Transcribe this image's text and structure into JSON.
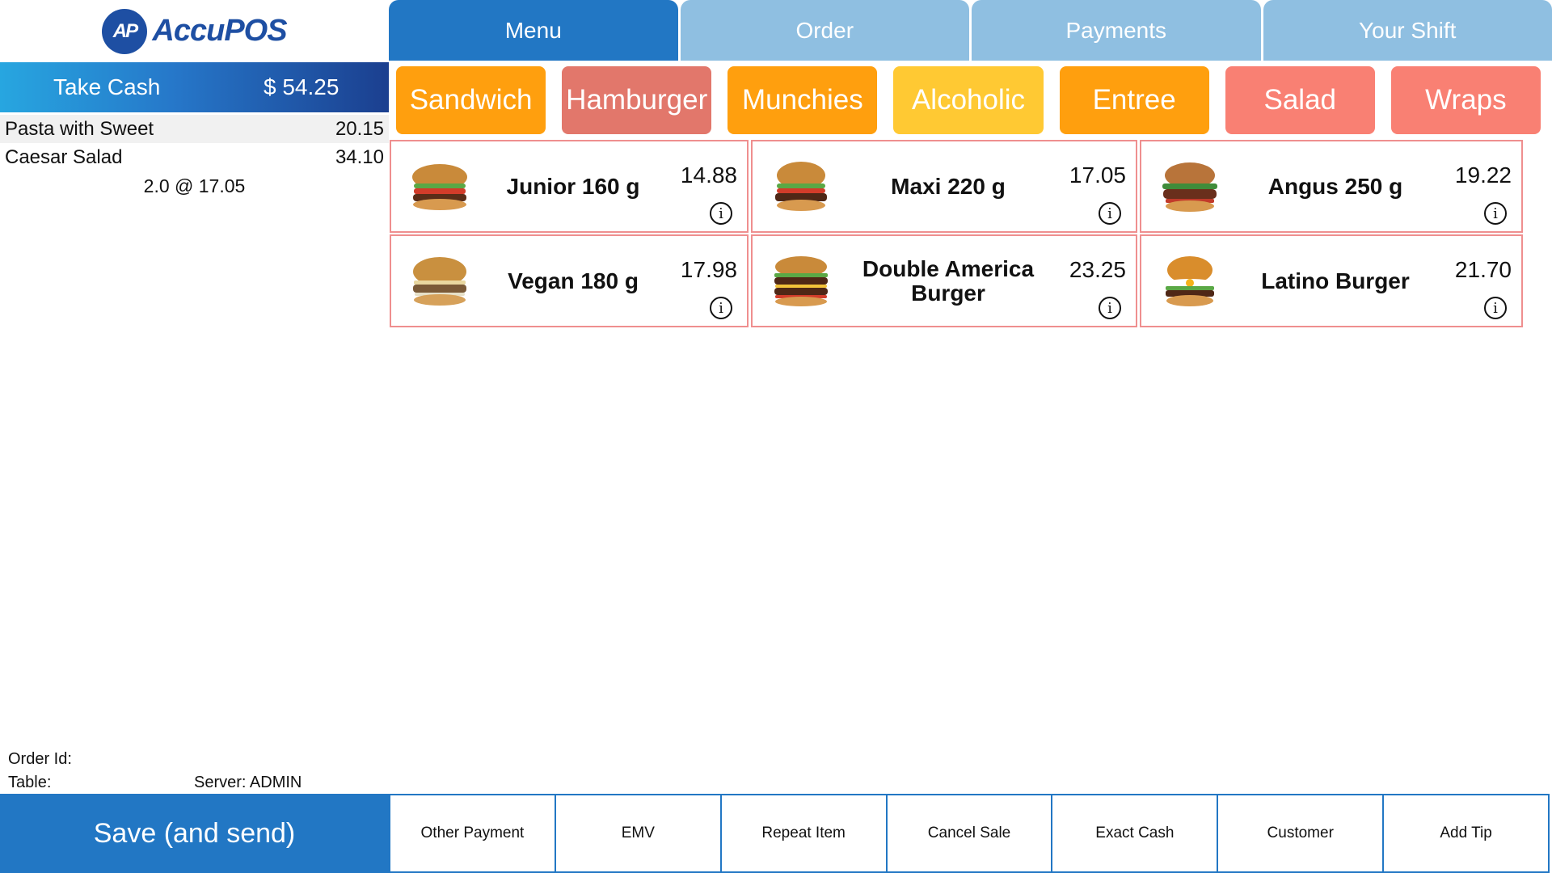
{
  "logo": {
    "badge": "AP",
    "text": "AccuPOS"
  },
  "tabs": [
    {
      "label": "Menu"
    },
    {
      "label": "Order"
    },
    {
      "label": "Payments"
    },
    {
      "label": "Your Shift"
    }
  ],
  "take_cash": {
    "label": "Take Cash",
    "amount": "$ 54.25"
  },
  "order": {
    "items": [
      {
        "name": "Pasta with Sweet",
        "price": "20.15"
      },
      {
        "name": "Caesar Salad",
        "price": "34.10"
      }
    ],
    "detail": "2.0 @ 17.05"
  },
  "categories": [
    {
      "label": "Sandwich",
      "color": "#ff9f0e"
    },
    {
      "label": "Hamburger",
      "color": "#e2776b"
    },
    {
      "label": "Munchies",
      "color": "#ff9f0e"
    },
    {
      "label": "Alcoholic",
      "color": "#ffc933"
    },
    {
      "label": "Entree",
      "color": "#ff9f0e"
    },
    {
      "label": "Salad",
      "color": "#f98073"
    },
    {
      "label": "Wraps",
      "color": "#f98073"
    }
  ],
  "products": [
    {
      "name": "Junior 160 g",
      "price": "14.88"
    },
    {
      "name": "Maxi 220 g",
      "price": "17.05"
    },
    {
      "name": "Angus 250 g",
      "price": "19.22"
    },
    {
      "name": "Vegan 180 g",
      "price": "17.98"
    },
    {
      "name": "Double America Burger",
      "price": "23.25"
    },
    {
      "name": "Latino Burger",
      "price": "21.70"
    }
  ],
  "info_glyph": "i",
  "footer": {
    "order_id": "Order Id:",
    "table": "Table:",
    "server": "Server: ADMIN"
  },
  "save_button": "Save (and send)",
  "actions": [
    {
      "label": "Other Payment"
    },
    {
      "label": "EMV"
    },
    {
      "label": "Repeat Item"
    },
    {
      "label": "Cancel Sale"
    },
    {
      "label": "Exact Cash"
    },
    {
      "label": "Customer"
    },
    {
      "label": "Add Tip"
    }
  ],
  "colors": {
    "primary": "#2277c4",
    "tab_inactive": "#8fbfe1",
    "product_border": "#ef8f8f"
  }
}
